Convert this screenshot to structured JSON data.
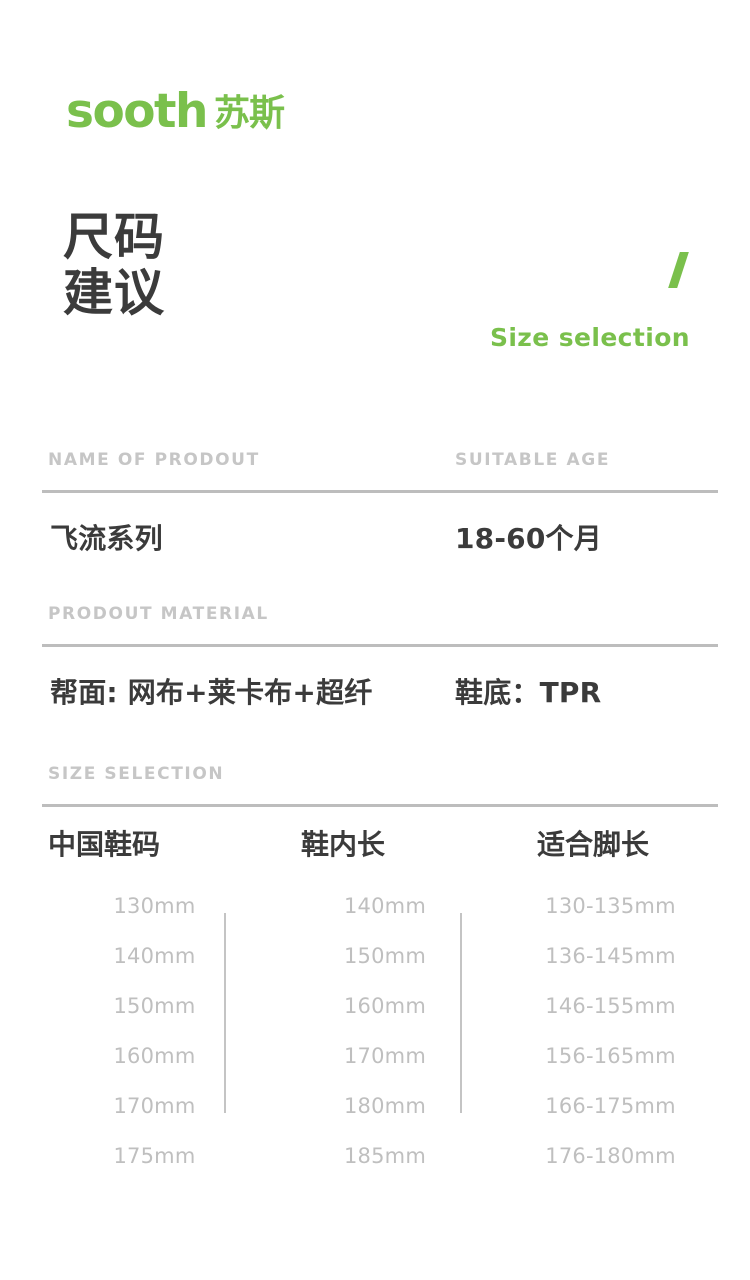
{
  "brand": {
    "latin": "sooth",
    "chinese": "苏斯",
    "color": "#7AC04C"
  },
  "title": {
    "line1": "尺码",
    "line2": "建议"
  },
  "subtitle": {
    "slash": "/",
    "english": "Size selection",
    "color": "#7AC04C"
  },
  "product_info": {
    "headers": [
      "NAME OF PRODOUT",
      "SUITABLE AGE"
    ],
    "values": [
      "飞流系列",
      "18-60个月"
    ]
  },
  "material": {
    "header": "PRODOUT MATERIAL",
    "values": [
      "帮面: 网布+莱卡布+超纤",
      "鞋底：TPR"
    ]
  },
  "size_selection": {
    "header": "SIZE SELECTION",
    "columns": [
      "中国鞋码",
      "鞋内长",
      "适合脚长"
    ],
    "rows": [
      [
        "130mm",
        "140mm",
        "130-135mm"
      ],
      [
        "140mm",
        "150mm",
        "136-145mm"
      ],
      [
        "150mm",
        "160mm",
        "146-155mm"
      ],
      [
        "160mm",
        "170mm",
        "156-165mm"
      ],
      [
        "170mm",
        "180mm",
        "166-175mm"
      ],
      [
        "175mm",
        "185mm",
        "176-180mm"
      ]
    ]
  },
  "colors": {
    "accent_green": "#7AC04C",
    "heading_gray": "#c6c6c6",
    "text_dark": "#3b3b3b",
    "rule_gray": "#bdbdbd",
    "data_gray": "#bfbfbf"
  }
}
